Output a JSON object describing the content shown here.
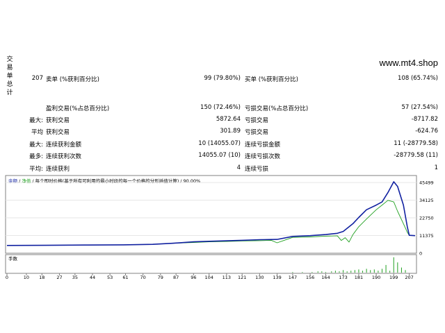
{
  "site": "www.mt4.shop",
  "side_title": [
    "交",
    "易",
    "单",
    "总",
    "计"
  ],
  "stats": {
    "r1": {
      "total": "207",
      "short_label": "卖单 (%获利百分比)",
      "short_val": "99 (79.80%)",
      "long_label": "买单 (%获利百分比)",
      "long_val": "108 (65.74%)"
    },
    "r2": {
      "win_label": "盈利交易(%占总百分比)",
      "win_val": "150 (72.46%)",
      "loss_label": "亏损交易(%占总百分比)",
      "loss_val": "57 (27.54%)"
    },
    "r3": {
      "prefix": "最大:",
      "win_label": "获利交易",
      "win_val": "5872.64",
      "loss_label": "亏损交易",
      "loss_val": "-8717.82"
    },
    "r4": {
      "prefix": "平均",
      "win_label": "获利交易",
      "win_val": "301.89",
      "loss_label": "亏损交易",
      "loss_val": "-624.76"
    },
    "r5": {
      "prefix": "最大:",
      "win_label": "连续获利金额",
      "win_val": "10 (14055.07)",
      "loss_label": "连续亏损金额",
      "loss_val": "11 (-28779.58)"
    },
    "r6": {
      "prefix": "最多:",
      "win_label": "连续获利次数",
      "win_val": "14055.07 (10)",
      "loss_label": "连续亏损次数",
      "loss_val": "-28779.58 (11)"
    },
    "r7": {
      "prefix": "平均:",
      "win_label": "连续获利",
      "win_val": "4",
      "loss_label": "连续亏损",
      "loss_val": "1"
    }
  },
  "legend": {
    "balance": "余额",
    "sep1": " / ",
    "equity": "净值",
    "sep2": " / ",
    "desc": "每个即时价格(基于所有可利用的最小时段的每一个价格的分形插值计算) / 90.00%"
  },
  "volume_label": "手数",
  "colors": {
    "balance": "#1020a0",
    "equity": "#20a020",
    "volume": "#20a020"
  },
  "chart_data": {
    "type": "line",
    "y_ticks": [
      45499,
      34125,
      22750,
      11375,
      0
    ],
    "ylim": [
      0,
      50000
    ],
    "x_ticks": [
      0,
      10,
      18,
      27,
      35,
      44,
      53,
      61,
      70,
      79,
      87,
      96,
      104,
      113,
      121,
      130,
      139,
      147,
      156,
      164,
      173,
      181,
      190,
      199,
      207
    ],
    "xlim": [
      0,
      210
    ],
    "series": [
      {
        "name": "余额",
        "points": [
          [
            0,
            5000
          ],
          [
            20,
            5100
          ],
          [
            40,
            5250
          ],
          [
            60,
            5400
          ],
          [
            75,
            5700
          ],
          [
            85,
            6400
          ],
          [
            96,
            7300
          ],
          [
            104,
            7700
          ],
          [
            113,
            8000
          ],
          [
            121,
            8300
          ],
          [
            130,
            8700
          ],
          [
            139,
            8900
          ],
          [
            147,
            10800
          ],
          [
            156,
            11300
          ],
          [
            164,
            12000
          ],
          [
            170,
            12800
          ],
          [
            173,
            14000
          ],
          [
            178,
            19000
          ],
          [
            181,
            23000
          ],
          [
            185,
            28000
          ],
          [
            190,
            31000
          ],
          [
            193,
            33000
          ],
          [
            196,
            39000
          ],
          [
            199,
            46000
          ],
          [
            201,
            43000
          ],
          [
            204,
            31000
          ],
          [
            206,
            17000
          ],
          [
            207,
            11500
          ],
          [
            210,
            11300
          ]
        ]
      },
      {
        "name": "净值",
        "points": [
          [
            0,
            5000
          ],
          [
            20,
            5100
          ],
          [
            40,
            5250
          ],
          [
            60,
            5400
          ],
          [
            75,
            5700
          ],
          [
            85,
            6400
          ],
          [
            96,
            6900
          ],
          [
            104,
            7300
          ],
          [
            113,
            7600
          ],
          [
            121,
            7900
          ],
          [
            130,
            8100
          ],
          [
            136,
            8300
          ],
          [
            139,
            6700
          ],
          [
            142,
            8000
          ],
          [
            147,
            10200
          ],
          [
            156,
            10500
          ],
          [
            164,
            11000
          ],
          [
            170,
            11200
          ],
          [
            172,
            8200
          ],
          [
            174,
            10000
          ],
          [
            176,
            7200
          ],
          [
            178,
            12000
          ],
          [
            181,
            17000
          ],
          [
            185,
            22000
          ],
          [
            190,
            28000
          ],
          [
            193,
            31000
          ],
          [
            196,
            34000
          ],
          [
            199,
            33000
          ],
          [
            201,
            27000
          ],
          [
            204,
            19000
          ],
          [
            206,
            13500
          ],
          [
            207,
            11500
          ],
          [
            210,
            11300
          ]
        ]
      }
    ],
    "volume": {
      "label": "手数",
      "bars": [
        [
          147,
          1
        ],
        [
          152,
          1
        ],
        [
          157,
          1
        ],
        [
          160,
          2
        ],
        [
          162,
          2
        ],
        [
          164,
          1
        ],
        [
          167,
          2
        ],
        [
          169,
          3
        ],
        [
          171,
          2
        ],
        [
          173,
          4
        ],
        [
          175,
          2
        ],
        [
          177,
          3
        ],
        [
          179,
          4
        ],
        [
          181,
          5
        ],
        [
          183,
          3
        ],
        [
          185,
          6
        ],
        [
          187,
          4
        ],
        [
          189,
          5
        ],
        [
          191,
          3
        ],
        [
          193,
          6
        ],
        [
          195,
          12
        ],
        [
          197,
          3
        ],
        [
          199,
          24
        ],
        [
          201,
          16
        ],
        [
          203,
          8
        ],
        [
          205,
          4
        ]
      ],
      "ymax": 26
    }
  }
}
